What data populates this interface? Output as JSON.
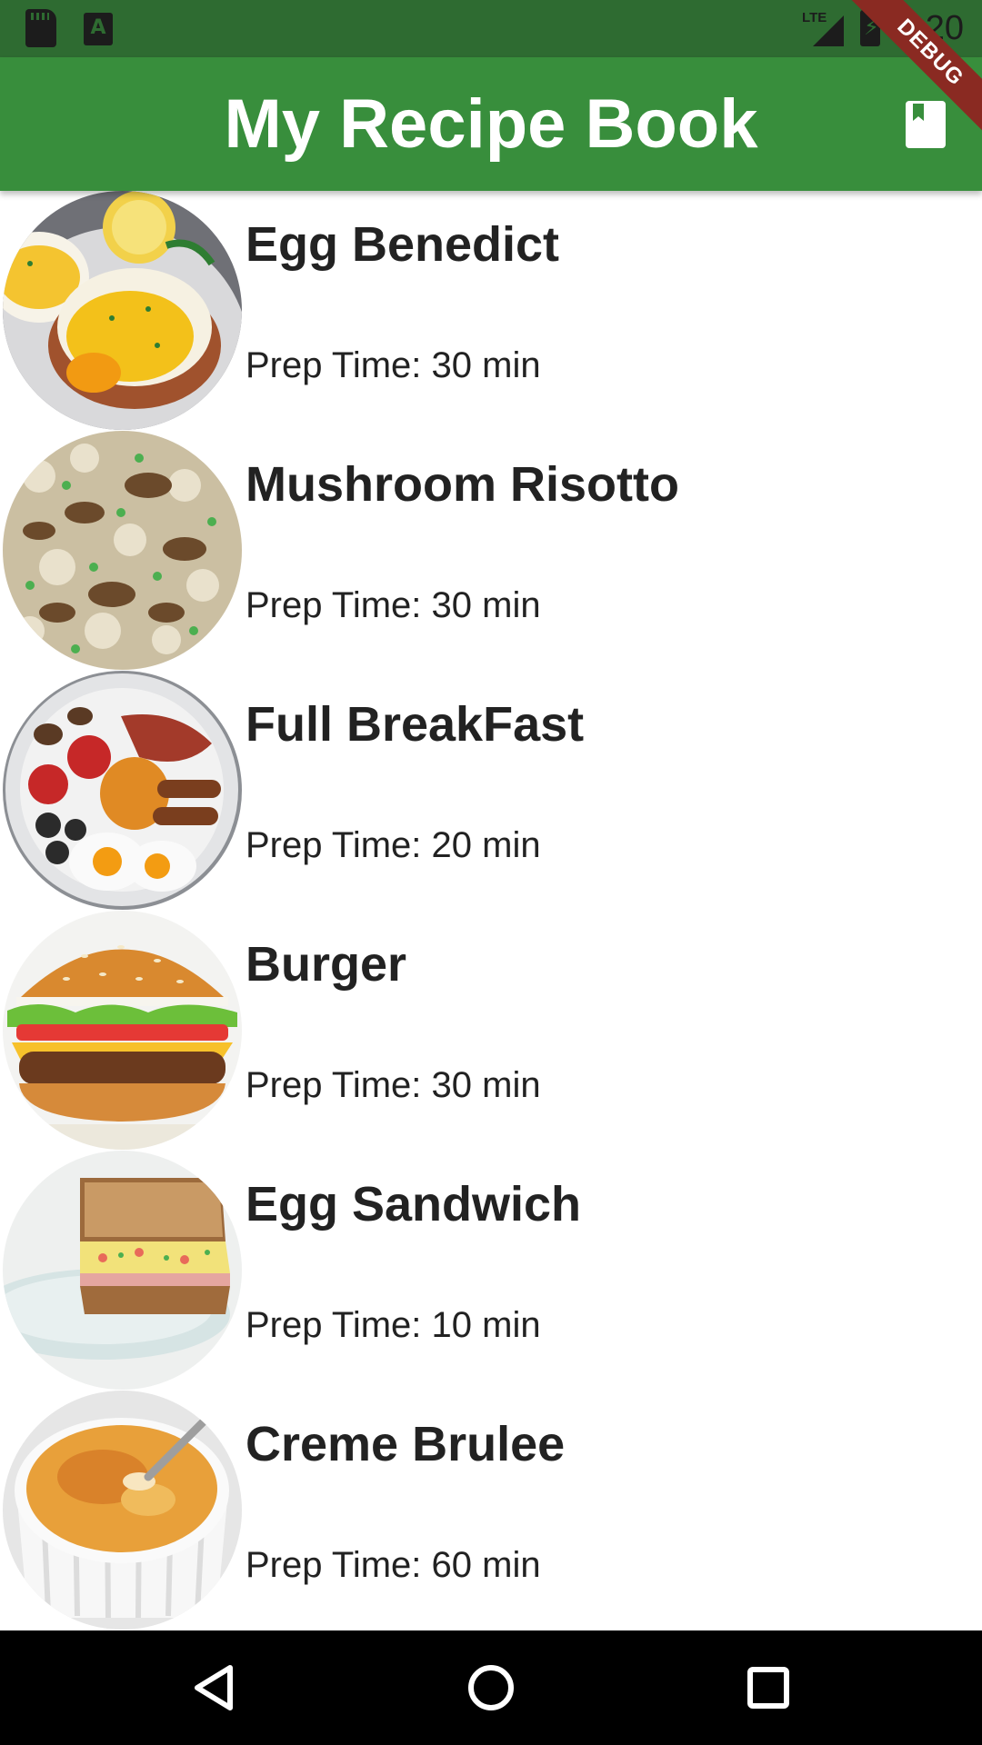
{
  "status_bar": {
    "time": "4:20",
    "network": "LTE",
    "icons": [
      "sd-card-icon",
      "a-notification-icon",
      "signal-icon",
      "battery-charging-icon"
    ]
  },
  "app_bar": {
    "title": "My Recipe Book",
    "action_icon": "book-icon",
    "debug_banner": "DEBUG",
    "color": "#388e3c",
    "status_color": "#2e6b31"
  },
  "recipes": [
    {
      "name": "Egg Benedict",
      "prep": "Prep Time: 30 min"
    },
    {
      "name": "Mushroom Risotto",
      "prep": "Prep Time: 30 min"
    },
    {
      "name": "Full BreakFast",
      "prep": "Prep Time: 20 min"
    },
    {
      "name": "Burger",
      "prep": "Prep Time: 30 min"
    },
    {
      "name": "Egg Sandwich",
      "prep": "Prep Time: 10 min"
    },
    {
      "name": "Creme Brulee",
      "prep": "Prep Time: 60 min"
    }
  ],
  "nav_bar": {
    "icons": [
      "back-icon",
      "home-icon",
      "recents-icon"
    ]
  }
}
